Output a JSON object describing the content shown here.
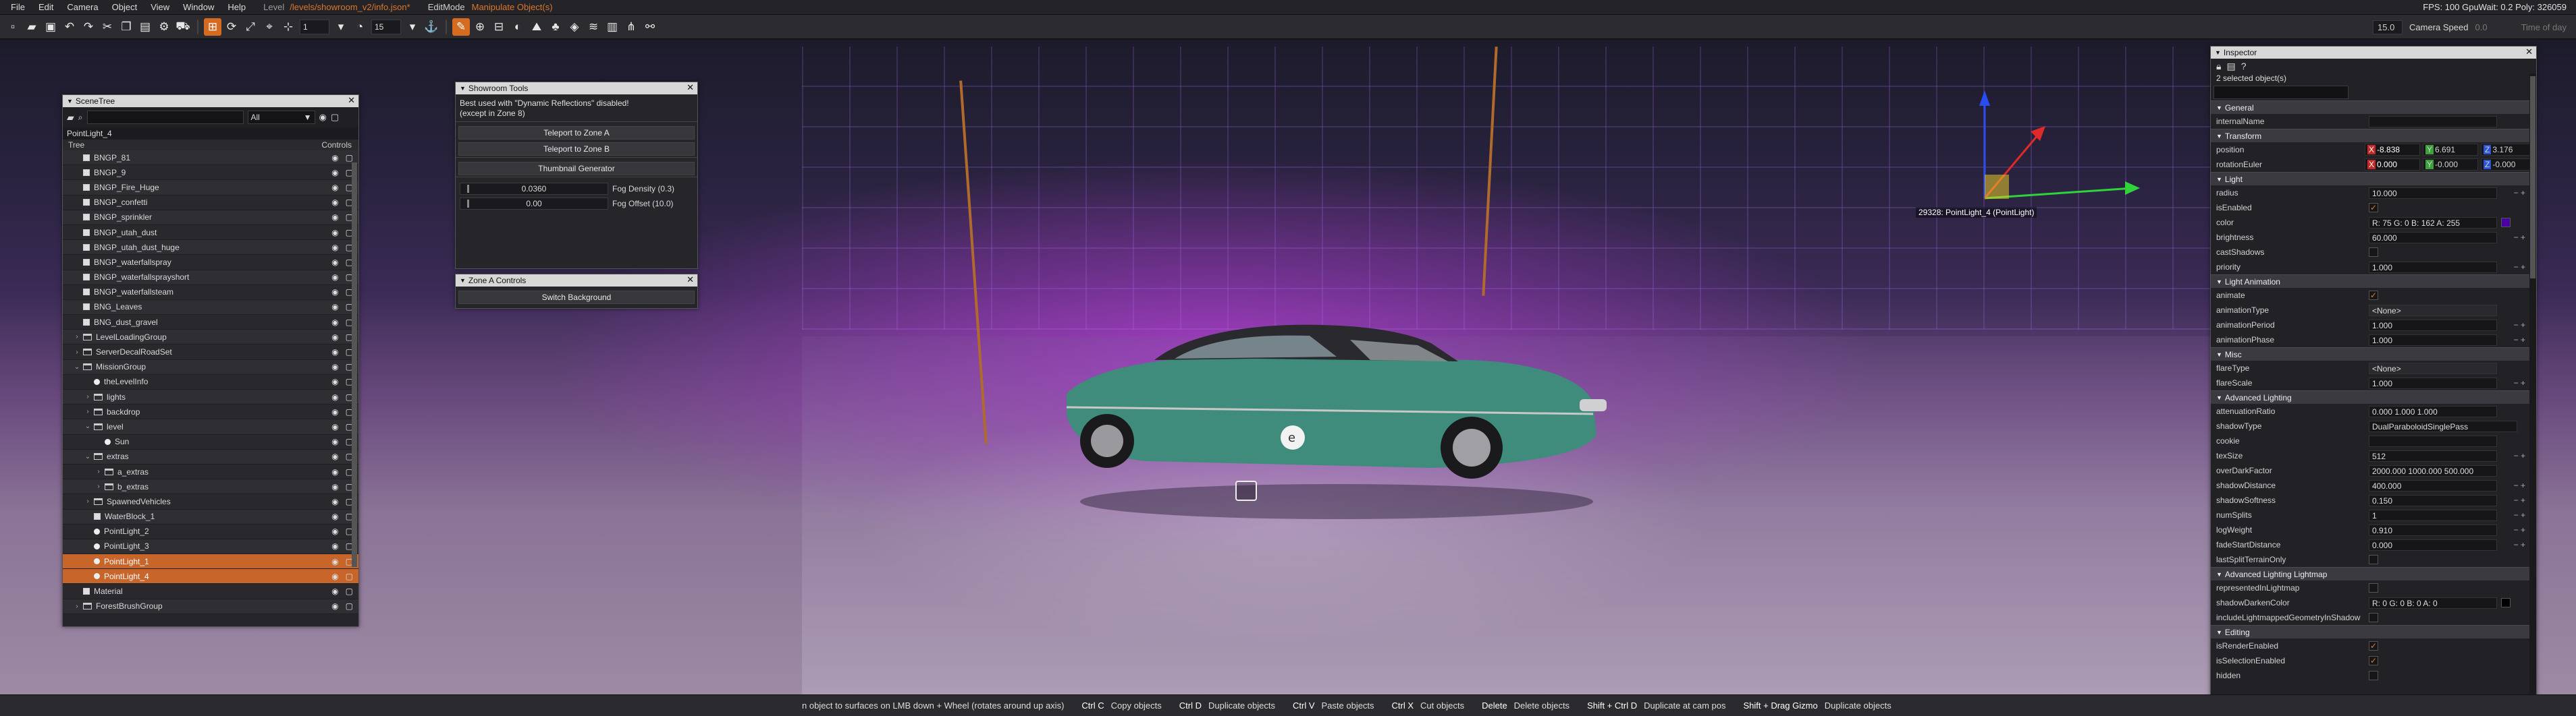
{
  "menubar": {
    "items": [
      "File",
      "Edit",
      "Camera",
      "Object",
      "View",
      "Window",
      "Help"
    ],
    "level_label": "Level",
    "level_path": "/levels/showroom_v2/info.json*",
    "edit_mode_label": "EditMode",
    "edit_mode_value": "Manipulate Object(s)",
    "stats": "FPS: 100  GpuWait: 0.2  Poly: 326059"
  },
  "toolbar": {
    "snap_value": "1",
    "rot_value": "15",
    "camera_speed_value": "15.0",
    "camera_speed_label": "Camera Speed",
    "camera_speed_num": "0.0",
    "time_of_day_label": "Time of day"
  },
  "viewport": {
    "object_label": "29328: PointLight_4 (PointLight)"
  },
  "scenetree": {
    "title": "SceneTree",
    "filter": "All",
    "selected_name": "PointLight_4",
    "col_tree": "Tree",
    "col_controls": "Controls",
    "rows": [
      {
        "label": "BNGP_81",
        "indent": 0,
        "icon": "box",
        "exp": ""
      },
      {
        "label": "BNGP_9",
        "indent": 0,
        "icon": "box",
        "exp": ""
      },
      {
        "label": "BNGP_Fire_Huge",
        "indent": 0,
        "icon": "box",
        "exp": ""
      },
      {
        "label": "BNGP_confetti",
        "indent": 0,
        "icon": "box",
        "exp": ""
      },
      {
        "label": "BNGP_sprinkler",
        "indent": 0,
        "icon": "box",
        "exp": ""
      },
      {
        "label": "BNGP_utah_dust",
        "indent": 0,
        "icon": "box",
        "exp": ""
      },
      {
        "label": "BNGP_utah_dust_huge",
        "indent": 0,
        "icon": "box",
        "exp": ""
      },
      {
        "label": "BNGP_waterfallspray",
        "indent": 0,
        "icon": "box",
        "exp": ""
      },
      {
        "label": "BNGP_waterfallsprayshort",
        "indent": 0,
        "icon": "box",
        "exp": ""
      },
      {
        "label": "BNGP_waterfallsteam",
        "indent": 0,
        "icon": "box",
        "exp": ""
      },
      {
        "label": "BNG_Leaves",
        "indent": 0,
        "icon": "box",
        "exp": ""
      },
      {
        "label": "BNG_dust_gravel",
        "indent": 0,
        "icon": "box",
        "exp": ""
      },
      {
        "label": "LevelLoadingGroup",
        "indent": 0,
        "icon": "fold",
        "exp": "›"
      },
      {
        "label": "ServerDecalRoadSet",
        "indent": 0,
        "icon": "fold",
        "exp": "›"
      },
      {
        "label": "MissionGroup",
        "indent": 0,
        "icon": "fold",
        "exp": "⌄"
      },
      {
        "label": "theLevelInfo",
        "indent": 1,
        "icon": "light",
        "exp": ""
      },
      {
        "label": "lights",
        "indent": 1,
        "icon": "fold",
        "exp": "›"
      },
      {
        "label": "backdrop",
        "indent": 1,
        "icon": "fold",
        "exp": "›"
      },
      {
        "label": "level",
        "indent": 1,
        "icon": "fold",
        "exp": "⌄"
      },
      {
        "label": "Sun",
        "indent": 2,
        "icon": "light",
        "exp": ""
      },
      {
        "label": "extras",
        "indent": 1,
        "icon": "fold",
        "exp": "⌄"
      },
      {
        "label": "a_extras",
        "indent": 2,
        "icon": "fold",
        "exp": "›"
      },
      {
        "label": "b_extras",
        "indent": 2,
        "icon": "fold",
        "exp": "›"
      },
      {
        "label": "SpawnedVehicles",
        "indent": 1,
        "icon": "fold",
        "exp": "›"
      },
      {
        "label": "WaterBlock_1",
        "indent": 1,
        "icon": "box",
        "exp": ""
      },
      {
        "label": "PointLight_2",
        "indent": 1,
        "icon": "light",
        "exp": ""
      },
      {
        "label": "PointLight_3",
        "indent": 1,
        "icon": "light",
        "exp": ""
      },
      {
        "label": "PointLight_1",
        "indent": 1,
        "icon": "light",
        "exp": "",
        "sel": true
      },
      {
        "label": "PointLight_4",
        "indent": 1,
        "icon": "light",
        "exp": "",
        "sel": true
      },
      {
        "label": "Material",
        "indent": 0,
        "icon": "box",
        "exp": ""
      },
      {
        "label": "ForestBrushGroup",
        "indent": 0,
        "icon": "fold",
        "exp": "›"
      }
    ]
  },
  "showroom": {
    "title": "Showroom Tools",
    "message_1": "Best used with \"Dynamic Reflections\" disabled!",
    "message_2": "(except in Zone 8)",
    "btn_zone_a": "Teleport to Zone A",
    "btn_zone_b": "Teleport to Zone B",
    "btn_thumb": "Thumbnail Generator",
    "fog_density_value": "0.0360",
    "fog_density_label": "Fog Density (0.3)",
    "fog_offset_value": "0.00",
    "fog_offset_label": "Fog Offset (10.0)"
  },
  "zoneA": {
    "title": "Zone A Controls",
    "btn_switch": "Switch Background"
  },
  "inspector": {
    "title": "Inspector",
    "count": "2 selected object(s)",
    "sections": [
      {
        "title": "General",
        "rows": [
          {
            "label": "internalName",
            "type": "text",
            "value": ""
          }
        ]
      },
      {
        "title": "Transform",
        "rows": [
          {
            "label": "position",
            "type": "xyz",
            "x": "-8.838",
            "y": "6.691",
            "z": "3.176"
          },
          {
            "label": "rotationEuler",
            "type": "xyz",
            "x": "0.000",
            "y": "-0.000",
            "z": "-0.000"
          }
        ]
      },
      {
        "title": "Light",
        "rows": [
          {
            "label": "radius",
            "type": "num",
            "value": "10.000"
          },
          {
            "label": "isEnabled",
            "type": "check",
            "value": "✓"
          },
          {
            "label": "color",
            "type": "color",
            "value": "R: 75    G: 0    B: 162    A: 255"
          },
          {
            "label": "brightness",
            "type": "num",
            "value": "60.000"
          },
          {
            "label": "castShadows",
            "type": "check",
            "value": ""
          },
          {
            "label": "priority",
            "type": "num",
            "value": "1.000"
          }
        ]
      },
      {
        "title": "Light Animation",
        "rows": [
          {
            "label": "animate",
            "type": "check",
            "value": "✓"
          },
          {
            "label": "animationType",
            "type": "drop",
            "value": "<None>"
          },
          {
            "label": "animationPeriod",
            "type": "num",
            "value": "1.000"
          },
          {
            "label": "animationPhase",
            "type": "num",
            "value": "1.000"
          }
        ]
      },
      {
        "title": "Misc",
        "rows": [
          {
            "label": "flareType",
            "type": "drop",
            "value": "<None>"
          },
          {
            "label": "flareScale",
            "type": "num",
            "value": "1.000"
          }
        ]
      },
      {
        "title": "Advanced Lighting",
        "rows": [
          {
            "label": "attenuationRatio",
            "type": "tri",
            "value": "0.000        1.000        1.000"
          },
          {
            "label": "shadowType",
            "type": "drop2",
            "value": "DualParaboloidSinglePass"
          },
          {
            "label": "cookie",
            "type": "text",
            "value": ""
          },
          {
            "label": "texSize",
            "type": "num",
            "value": "512"
          },
          {
            "label": "overDarkFactor",
            "type": "tri",
            "value": "2000.000    1000.000    500.000"
          },
          {
            "label": "shadowDistance",
            "type": "num",
            "value": "400.000"
          },
          {
            "label": "shadowSoftness",
            "type": "num",
            "value": "0.150"
          },
          {
            "label": "numSplits",
            "type": "num",
            "value": "1"
          },
          {
            "label": "logWeight",
            "type": "num",
            "value": "0.910"
          },
          {
            "label": "fadeStartDistance",
            "type": "num",
            "value": "0.000"
          },
          {
            "label": "lastSplitTerrainOnly",
            "type": "check",
            "value": ""
          }
        ]
      },
      {
        "title": "Advanced Lighting Lightmap",
        "rows": [
          {
            "label": "representedInLightmap",
            "type": "check",
            "value": ""
          },
          {
            "label": "shadowDarkenColor",
            "type": "color2",
            "value": "R: 0    G: 0    B: 0    A: 0"
          },
          {
            "label": "includeLightmappedGeometryInShadow",
            "type": "check",
            "value": ""
          }
        ]
      },
      {
        "title": "Editing",
        "rows": [
          {
            "label": "isRenderEnabled",
            "type": "check",
            "value": "✓"
          },
          {
            "label": "isSelectionEnabled",
            "type": "check",
            "value": "✓"
          },
          {
            "label": "hidden",
            "type": "check",
            "value": ""
          }
        ]
      }
    ]
  },
  "statusbar": {
    "hint": "n object to surfaces on LMB down + Wheel (rotates around up axis)",
    "shortcuts": [
      {
        "key": "Ctrl C",
        "desc": "Copy objects"
      },
      {
        "key": "Ctrl D",
        "desc": "Duplicate objects"
      },
      {
        "key": "Ctrl V",
        "desc": "Paste objects"
      },
      {
        "key": "Ctrl X",
        "desc": "Cut objects"
      },
      {
        "key": "Delete",
        "desc": "Delete objects"
      },
      {
        "key": "Shift + Ctrl D",
        "desc": "Duplicate at cam pos"
      },
      {
        "key": "Shift + Drag Gizmo",
        "desc": "Duplicate objects"
      }
    ]
  },
  "colors": {
    "accent": "#d56a21",
    "selection": "#c8652a",
    "light_color": "#4b00a2"
  }
}
